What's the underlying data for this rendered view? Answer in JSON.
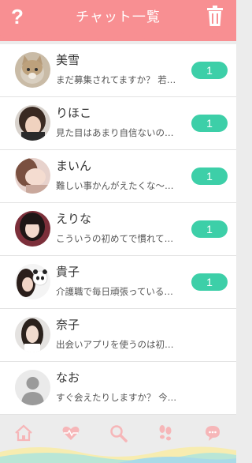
{
  "header": {
    "title": "チャット一覧",
    "help_label": "?",
    "help_icon": "question-mark-icon",
    "trash_icon": "trash-icon",
    "color": "#f88f92"
  },
  "chats": [
    {
      "name": "美雪",
      "message": "まだ募集されてますか？ 若…",
      "unread": "1",
      "avatar": "cat-photo"
    },
    {
      "name": "りほこ",
      "message": "見た目はあまり自信ないの…",
      "unread": "1",
      "avatar": "woman-photo"
    },
    {
      "name": "まいん",
      "message": "難しい事かんがえたくな〜…",
      "unread": "1",
      "avatar": "woman-photo"
    },
    {
      "name": "えりな",
      "message": "こういうの初めてで慣れて…",
      "unread": "1",
      "avatar": "woman-photo"
    },
    {
      "name": "貴子",
      "message": "介護職で毎日頑張っている…",
      "unread": "1",
      "avatar": "woman-with-panda-photo"
    },
    {
      "name": "奈子",
      "message": "出会いアプリを使うのは初…",
      "unread": "",
      "avatar": "woman-photo"
    },
    {
      "name": "なお",
      "message": "すぐ会えたりしますか？ 今…",
      "unread": "",
      "avatar": "default-silhouette"
    }
  ],
  "nav": {
    "items": [
      "home-icon",
      "heart-pulse-icon",
      "search-icon",
      "footprints-icon",
      "chat-bubble-icon"
    ]
  },
  "colors": {
    "accent": "#f88f92",
    "badge": "#3dcfa8",
    "footer_wave_yellow": "#f7ecb0",
    "footer_wave_green": "#b9e6d6",
    "footer_wave_blue": "#a9dbe8"
  }
}
